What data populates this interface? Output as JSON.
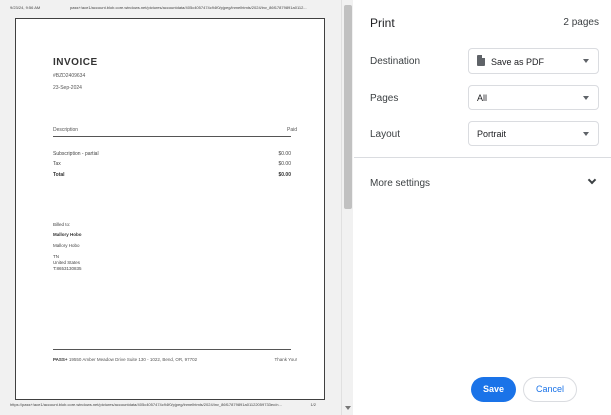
{
  "preview": {
    "header_date": "9/23/24, 9:56 AM",
    "header_url": "pass+/ace1/account.blob.core.windows.net/pictures/accountdata/405c4057474c94f0/pjpeg/inmelhtmls/2024/inv_86f17879891a0112...",
    "footer_url": "https://pass+/ace1/account.blob.core.windows.net/pictures/accountdata/405c4057474c94f0/pjpeg/inmelhtmls/2024/inv_86f17879891a01122059733ec/n...",
    "footer_page": "1/2",
    "invoice": {
      "title": "INVOICE",
      "number": "#BZD2409634",
      "date": "23-Sep-2024",
      "col_description": "Description",
      "col_paid": "Paid",
      "rows": [
        {
          "label": "Subscription - partial",
          "value": "$0.00"
        },
        {
          "label": "Tax",
          "value": "$0.00"
        },
        {
          "label": "Total",
          "value": "$0.00"
        }
      ],
      "billed_to_label": "Billed to:",
      "billed_name": "Mallory Hobo",
      "billed_name2": "Mallory Hobo",
      "billed_state": "TN",
      "billed_country": "United States",
      "billed_phone": "T:8653130835",
      "footer_brand": "PASS+",
      "footer_address": "19550 Amber Meadow Drive Suite 130 - 1022, Bend, OR, 97702",
      "footer_thanks": "Thank You!"
    }
  },
  "settings": {
    "title": "Print",
    "page_count": "2 pages",
    "destination_label": "Destination",
    "destination_value": "Save as PDF",
    "pages_label": "Pages",
    "pages_value": "All",
    "layout_label": "Layout",
    "layout_value": "Portrait",
    "more_settings": "More settings",
    "save_label": "Save",
    "cancel_label": "Cancel"
  },
  "colors": {
    "accent": "#1a73e8",
    "preview_bg": "#f1f1f1"
  },
  "icons": [
    "pdf-icon",
    "chevron-down-icon",
    "dropdown-caret-icon",
    "scroll-down-arrow-icon"
  ]
}
